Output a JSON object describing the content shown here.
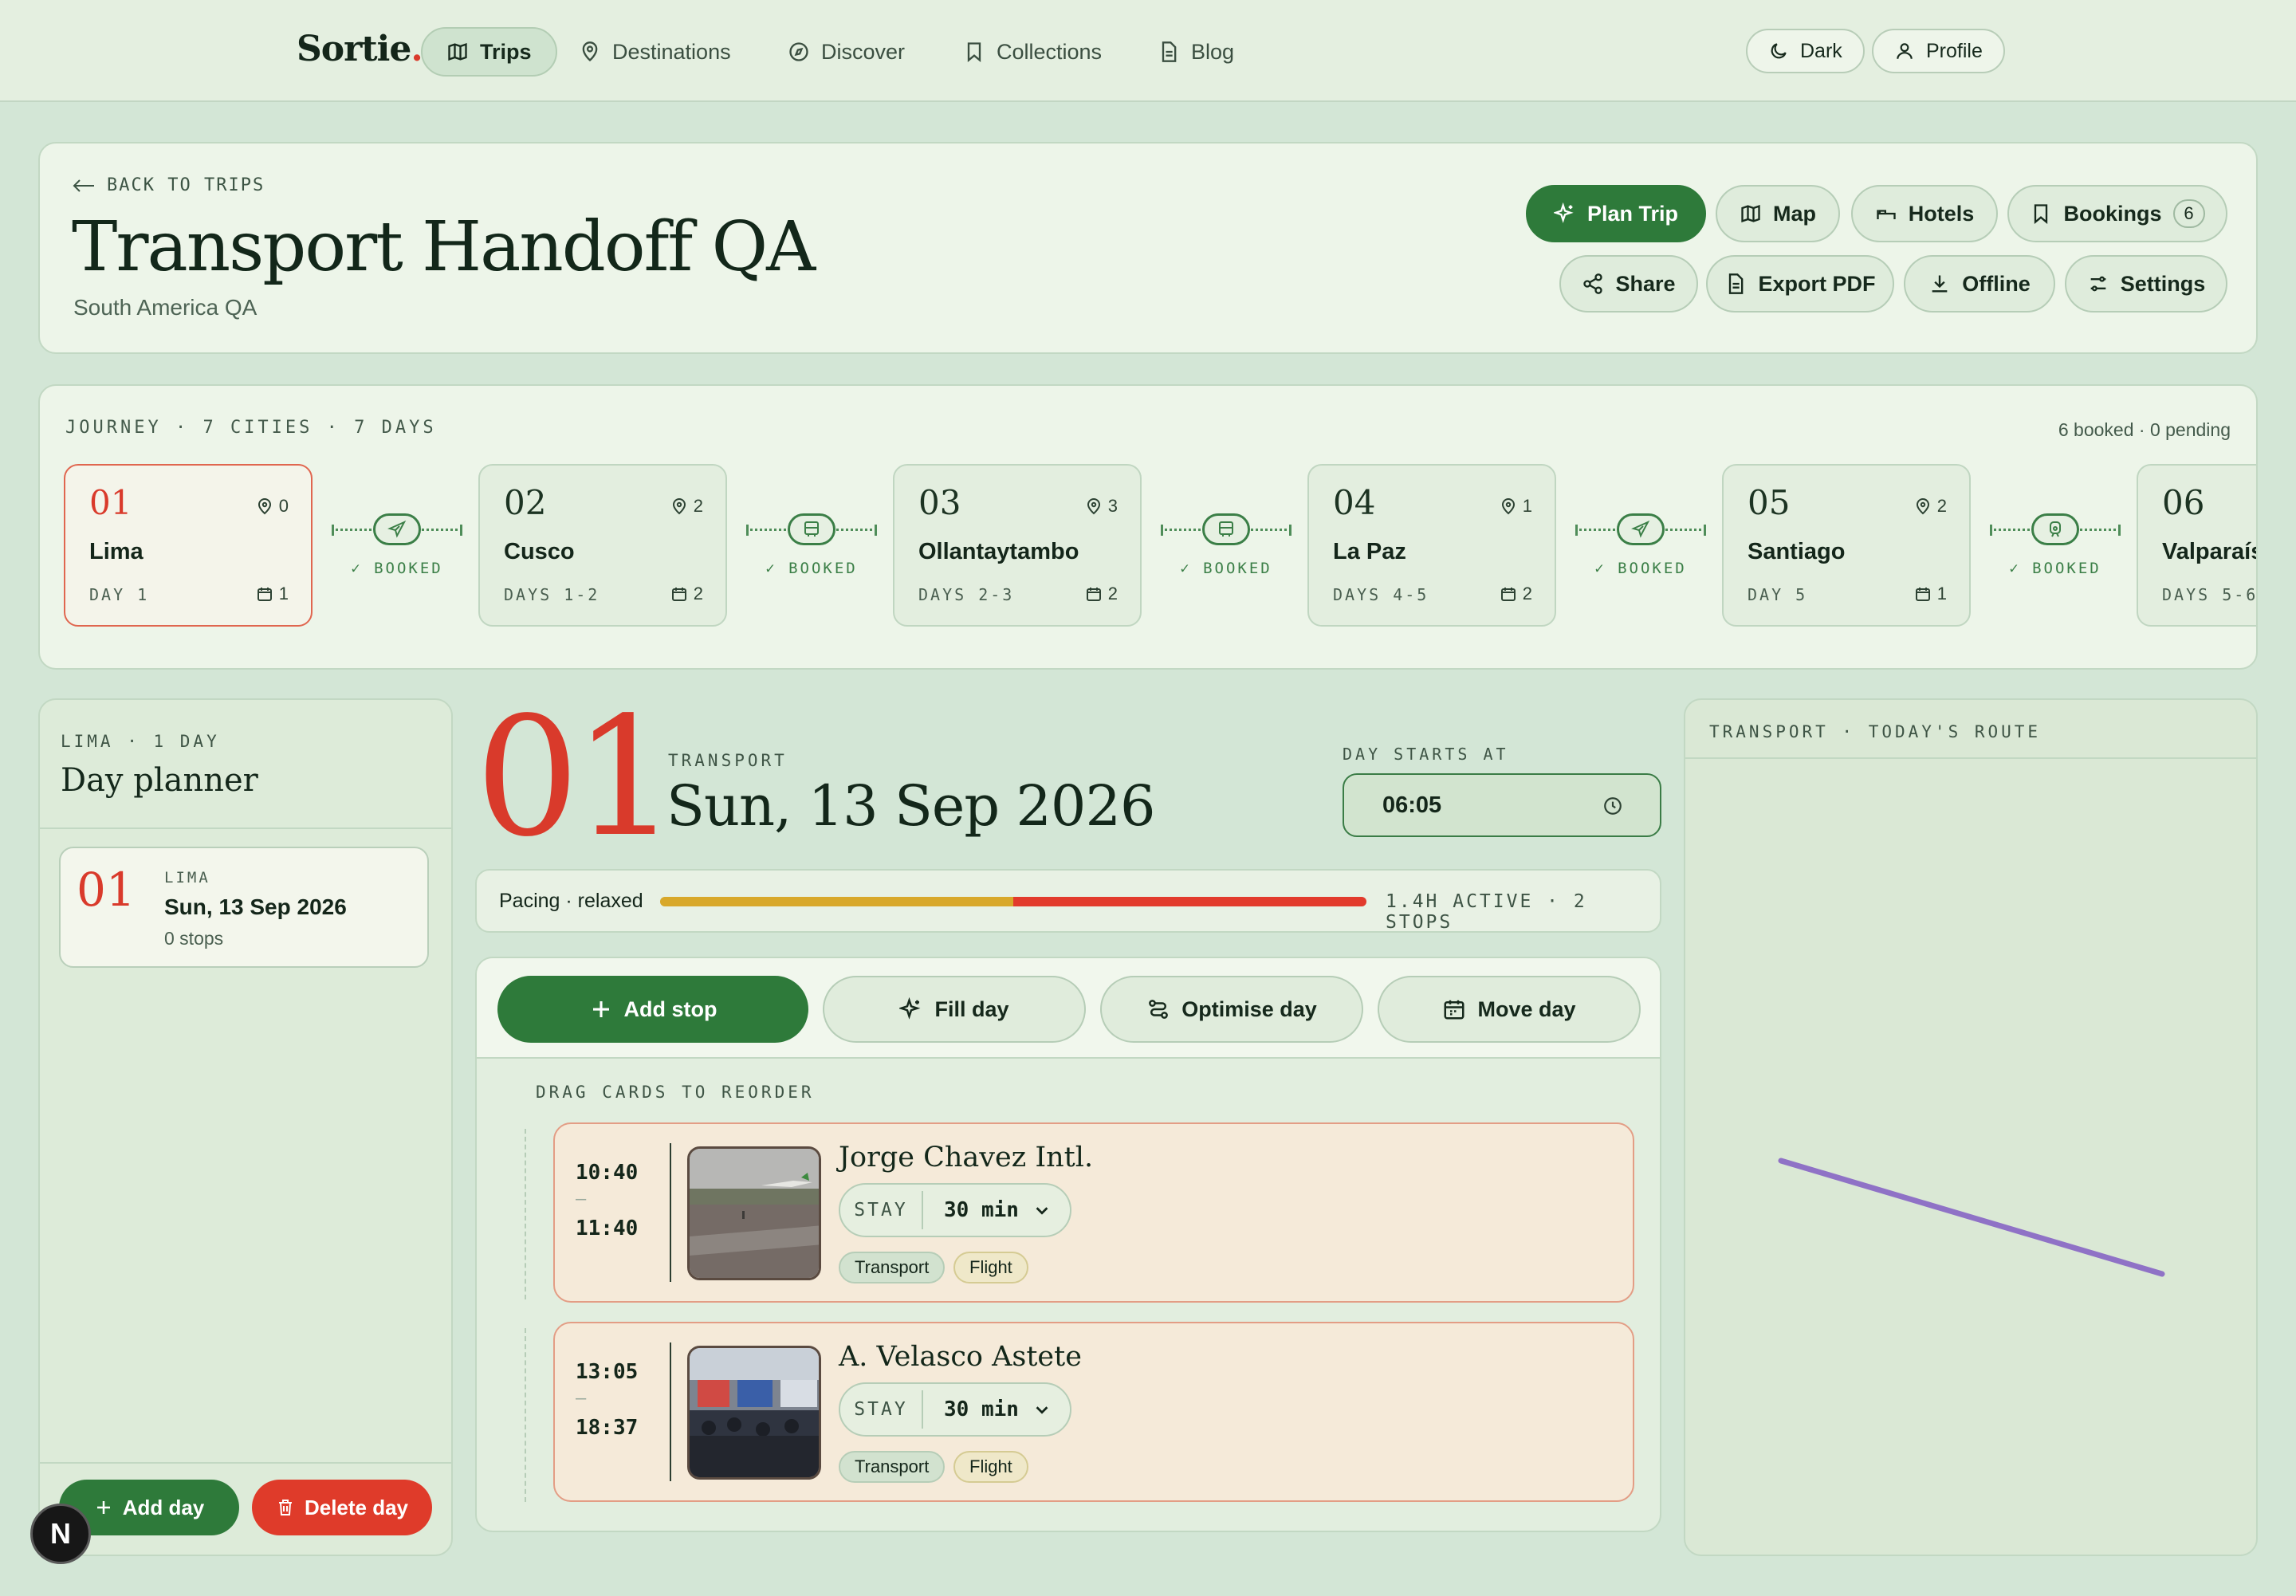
{
  "nav": {
    "logo": "Sortie",
    "logo_dot": ".",
    "items": [
      {
        "label": "Trips",
        "icon": "map-icon",
        "active": true
      },
      {
        "label": "Destinations",
        "icon": "pin-icon"
      },
      {
        "label": "Discover",
        "icon": "compass-icon"
      },
      {
        "label": "Collections",
        "icon": "bookmark-icon"
      },
      {
        "label": "Blog",
        "icon": "document-icon"
      }
    ],
    "dark_label": "Dark",
    "profile_label": "Profile"
  },
  "header": {
    "back_label": "BACK TO TRIPS",
    "title": "Transport Handoff QA",
    "subtitle": "South America QA",
    "actions": {
      "plan_trip": "Plan Trip",
      "map": "Map",
      "hotels": "Hotels",
      "bookings": "Bookings",
      "bookings_count": "6",
      "share": "Share",
      "export_pdf": "Export PDF",
      "offline": "Offline",
      "settings": "Settings"
    }
  },
  "journey": {
    "label": "JOURNEY · 7 CITIES · 7 DAYS",
    "status": "6 booked · 0 pending",
    "cities": [
      {
        "num": "01",
        "name": "Lima",
        "days": "DAY 1",
        "pins": "0",
        "cal": "1"
      },
      {
        "num": "02",
        "name": "Cusco",
        "days": "DAYS 1-2",
        "pins": "2",
        "cal": "2"
      },
      {
        "num": "03",
        "name": "Ollantaytambo",
        "days": "DAYS 2-3",
        "pins": "3",
        "cal": "2"
      },
      {
        "num": "04",
        "name": "La Paz",
        "days": "DAYS 4-5",
        "pins": "1",
        "cal": "2"
      },
      {
        "num": "05",
        "name": "Santiago",
        "days": "DAY 5",
        "pins": "2",
        "cal": "1"
      },
      {
        "num": "06",
        "name": "Valparaíso",
        "days": "DAYS 5-6",
        "pins": "",
        "cal": ""
      }
    ],
    "connectors": [
      {
        "icon": "plane-icon",
        "status": "✓ BOOKED"
      },
      {
        "icon": "bus-icon",
        "status": "✓ BOOKED"
      },
      {
        "icon": "bus-icon",
        "status": "✓ BOOKED"
      },
      {
        "icon": "plane-icon",
        "status": "✓ BOOKED"
      },
      {
        "icon": "train-icon",
        "status": "✓ BOOKED"
      }
    ]
  },
  "planner": {
    "eyebrow": "LIMA · 1 DAY",
    "title": "Day planner",
    "day": {
      "num": "01",
      "city": "LIMA",
      "date": "Sun, 13 Sep 2026",
      "stops": "0 stops"
    },
    "add_day": "Add day",
    "delete_day": "Delete day"
  },
  "badge_letter": "N",
  "day": {
    "num": "01",
    "eyebrow": "TRANSPORT",
    "date": "Sun, 13 Sep 2026",
    "starts_label": "DAY STARTS AT",
    "start_time": "06:05",
    "pacing_label": "Pacing · relaxed",
    "pacing_stats": "1.4H ACTIVE · 2 STOPS",
    "pacing_segments": [
      {
        "fraction": 0.5,
        "color": "#d8a82a"
      },
      {
        "fraction": 0.5,
        "color": "#e23b2c"
      }
    ]
  },
  "toolbar": {
    "add_stop": "Add stop",
    "fill_day": "Fill day",
    "optimise_day": "Optimise day",
    "move_day": "Move day",
    "drag_hint": "DRAG CARDS TO REORDER"
  },
  "stops": [
    {
      "start": "10:40",
      "dash": "—",
      "end": "11:40",
      "name": "Jorge Chavez Intl.",
      "stay_label": "STAY",
      "stay_value": "30 min",
      "tags": [
        "Transport",
        "Flight"
      ]
    },
    {
      "start": "13:05",
      "dash": "—",
      "end": "18:37",
      "name": "A. Velasco Astete",
      "stay_label": "STAY",
      "stay_value": "30 min",
      "tags": [
        "Transport",
        "Flight"
      ]
    }
  ],
  "map": {
    "label": "TRANSPORT · TODAY'S ROUTE",
    "route_color": "#8f72c6"
  },
  "colors": {
    "accent_green": "#2e7a3a",
    "accent_red": "#d93a2b",
    "background": "#d3e6d6"
  }
}
